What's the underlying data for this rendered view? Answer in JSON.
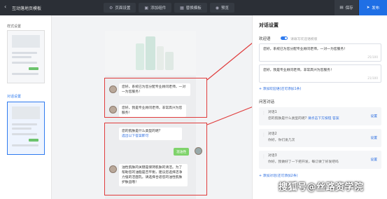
{
  "topbar": {
    "back_icon": "back-icon",
    "title": "互动落地页模板",
    "tabs": [
      {
        "label": "页面设置",
        "icon": "settings-icon"
      },
      {
        "label": "添加组件",
        "icon": "component-icon"
      },
      {
        "label": "替换模板",
        "icon": "template-icon"
      },
      {
        "label": "预览",
        "icon": "eye-icon"
      }
    ],
    "save_label": "保存",
    "publish_label": "发布"
  },
  "leftpanel": {
    "style_label": "样式设置",
    "dialog_label": "对话设置"
  },
  "preview": {
    "greeting_1": "您好，系统已为您分配专业顾问老师，一对一为您服务！",
    "greeting_2": "您好，我是专业顾问老师，非常高兴为您服务！",
    "question_1": "您的肌肤是什么类型的呢?",
    "question_1_link": "选出以下答案即可",
    "answer_1": "混油性",
    "reply_1": "油性肌肤的关键是保持肌肤的清洁。为了帮助您的油脂是否平衡，建议您选择洁净力强的洁面乳。请选择合适您的油性肌肤护肤品哦！"
  },
  "rightpanel": {
    "title": "对话设置",
    "welcome_label": "欢迎语",
    "welcome_hint": "请填写欢迎语模版",
    "welcome_1": "您好，系统已为您分配专业顾问老师，一对一为您服务！",
    "welcome_1_count": "25/100",
    "welcome_2": "您好，我是专业顾问老师，非常高兴为您服务！",
    "welcome_2_count": "21/100",
    "add_welcome": "+ 添加欢迎语(还可添加1条)",
    "question_label": "问答对话",
    "q1_title": "对话1",
    "q1_sub_prefix": "您的肌肤是什么类型的呢?",
    "q1_sub_link": "请点击下方按钮 答案",
    "q2_title": "对话2",
    "q2_sub": "你好，你们发几次",
    "q3_title": "对话3",
    "q3_sub": "你好，我做好了一下把开发，每订做了好发吧吗",
    "set_label": "设置",
    "add_question": "+ 添加对话(还可添加2条)"
  },
  "watermark": "搜狐号@丝路资学院",
  "colors": {
    "accent": "#1f6fe5",
    "highlight_box": "#e03c3c",
    "chat_green": "#7fd36b",
    "topbar": "#2b2f36"
  }
}
